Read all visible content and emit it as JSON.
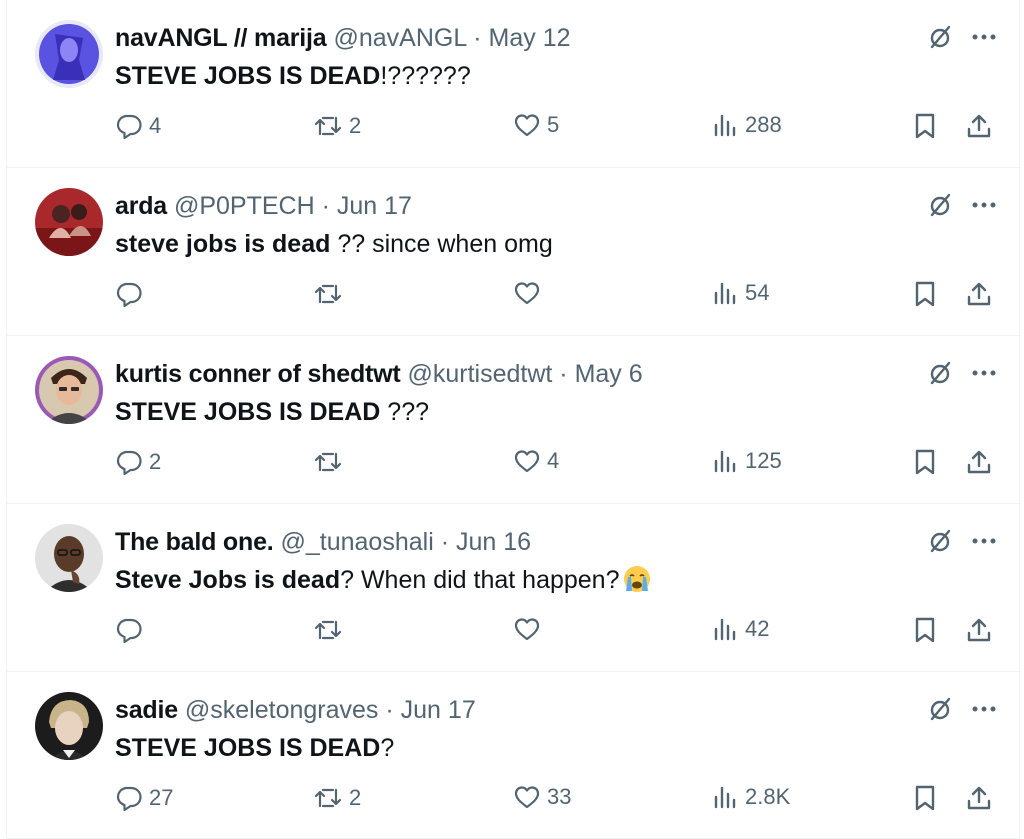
{
  "colors": {
    "text": "#0f1419",
    "muted": "#536471",
    "border": "#eff3f4"
  },
  "icons": {
    "grok": "grok-icon",
    "more": "more-icon",
    "reply": "reply-icon",
    "retweet": "retweet-icon",
    "like": "heart-icon",
    "views": "views-icon",
    "bookmark": "bookmark-icon",
    "share": "share-icon"
  },
  "tweets": [
    {
      "name": "navANGL // marija",
      "handle": "@navANGL",
      "dot": "·",
      "date": "May 12",
      "text_bold": "STEVE JOBS IS DEAD",
      "text_rest": "!??????",
      "replies": "4",
      "retweets": "2",
      "likes": "5",
      "views": "288"
    },
    {
      "name": "arda",
      "handle": "@P0PTECH",
      "dot": "·",
      "date": "Jun 17",
      "text_bold": "steve jobs is dead",
      "text_rest": " ?? since when omg",
      "replies": "",
      "retweets": "",
      "likes": "",
      "views": "54"
    },
    {
      "name": "kurtis conner of shedtwt",
      "handle": "@kurtisedtwt",
      "dot": "·",
      "date": "May 6",
      "text_bold": "STEVE JOBS IS DEAD",
      "text_rest": " ???",
      "replies": "2",
      "retweets": "",
      "likes": "4",
      "views": "125"
    },
    {
      "name": "The bald one.",
      "handle": "@_tunaoshali",
      "dot": "·",
      "date": "Jun 16",
      "text_bold": "Steve Jobs is dead",
      "text_rest": "? When did that happen?",
      "replies": "",
      "retweets": "",
      "likes": "",
      "views": "42"
    },
    {
      "name": "sadie",
      "handle": "@skeletongraves",
      "dot": "·",
      "date": "Jun 17",
      "text_bold": "STEVE JOBS IS DEAD",
      "text_rest": "?",
      "replies": "27",
      "retweets": "2",
      "likes": "33",
      "views": "2.8K"
    }
  ]
}
